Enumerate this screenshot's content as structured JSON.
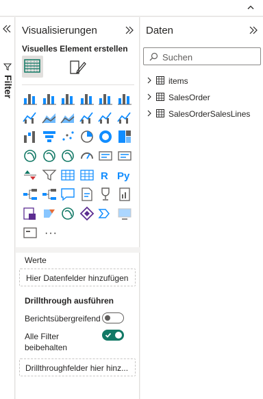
{
  "filter_pane": {
    "label": "Filter"
  },
  "visualizations": {
    "title": "Visualisierungen",
    "build_subtitle": "Visuelles Element erstellen",
    "more_label": "···",
    "fields": {
      "values_label": "Werte",
      "values_placeholder": "Hier Datenfelder hinzufügen"
    },
    "drillthrough": {
      "heading": "Drillthrough ausführen",
      "cross_report_label": "Berichtsübergreifend",
      "cross_report_on": false,
      "keep_filters_label": "Alle Filter beibehalten",
      "keep_filters_on": true,
      "placeholder": "Drillthroughfelder hier hinz..."
    },
    "icon_rows": [
      [
        "stacked-bar-chart-icon",
        "stacked-column-chart-icon",
        "clustered-bar-chart-icon",
        "clustered-column-chart-icon",
        "100-stacked-bar-chart-icon",
        "100-stacked-column-chart-icon"
      ],
      [
        "line-chart-icon",
        "area-chart-icon",
        "stacked-area-chart-icon",
        "line-and-stacked-column-chart-icon",
        "line-and-clustered-column-chart-icon",
        "ribbon-chart-icon"
      ],
      [
        "waterfall-chart-icon",
        "funnel-chart-icon",
        "scatter-chart-icon",
        "pie-chart-icon",
        "donut-chart-icon",
        "treemap-icon"
      ],
      [
        "map-icon",
        "filled-map-icon",
        "azure-map-icon",
        "gauge-icon",
        "card-icon",
        "multi-row-card-icon"
      ],
      [
        "kpi-icon",
        "slicer-icon",
        "table-icon",
        "matrix-icon",
        "r-visual-icon",
        "python-visual-icon"
      ],
      [
        "key-influencers-icon",
        "decomposition-tree-icon",
        "qa-icon",
        "smart-narrative-icon",
        "metrics-icon",
        "paginated-report-icon"
      ],
      [
        "powerapps-icon",
        "power-automate-icon",
        "arcgis-map-icon",
        "diamond-visual-icon",
        "dataflow-visual-icon",
        "tv-visual-icon"
      ],
      [
        "custom-visual-icon"
      ]
    ]
  },
  "data_pane": {
    "title": "Daten",
    "search_placeholder": "Suchen",
    "tables": [
      "items",
      "SalesOrder",
      "SalesOrderSalesLines"
    ]
  },
  "colors": {
    "accent": "#118DFF",
    "toggle_on": "#117865",
    "panel_bg": "#F3F2F1"
  }
}
